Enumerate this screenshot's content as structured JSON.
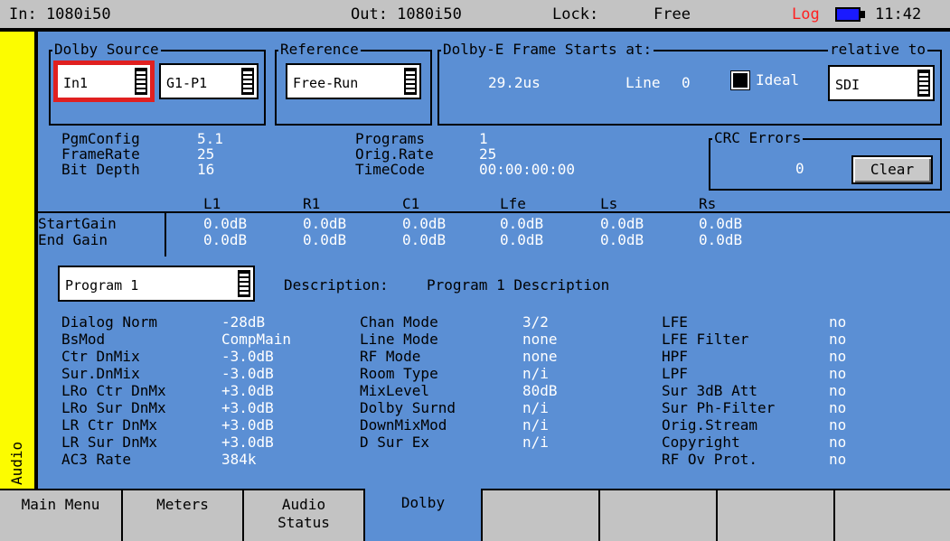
{
  "topbar": {
    "input": "In: 1080i50",
    "output": "Out: 1080i50",
    "lock_label": "Lock:",
    "lock_value": "Free",
    "log_label": "Log",
    "time": "11:42",
    "colors": {
      "log": "#ff2020",
      "battery": "#1a1aff"
    }
  },
  "side_label": "Audio",
  "dolby_source": {
    "label": "Dolby Source",
    "input_value": "In1",
    "program_value": "G1-P1"
  },
  "reference": {
    "label": "Reference",
    "value": "Free-Run"
  },
  "frame_start": {
    "label": "Dolby-E Frame Starts at:",
    "relative_label": "relative to",
    "time": "29.2us",
    "line_label": "Line",
    "line_value": "0",
    "ideal_label": "Ideal",
    "relative_value": "SDI"
  },
  "info_left": [
    {
      "label": "PgmConfig",
      "value": "5.1"
    },
    {
      "label": "FrameRate",
      "value": "25"
    },
    {
      "label": "Bit Depth",
      "value": "16"
    }
  ],
  "info_mid": [
    {
      "label": "Programs",
      "value": "1"
    },
    {
      "label": "Orig.Rate",
      "value": "25"
    },
    {
      "label": "TimeCode",
      "value": "00:00:00:00"
    }
  ],
  "crc": {
    "label": "CRC Errors",
    "value": "0",
    "clear_label": "Clear"
  },
  "gains": {
    "channels": [
      "L1",
      "R1",
      "C1",
      "Lfe",
      "Ls",
      "Rs"
    ],
    "start_label": "StartGain",
    "end_label": "End Gain",
    "start": [
      "0.0dB",
      "0.0dB",
      "0.0dB",
      "0.0dB",
      "0.0dB",
      "0.0dB"
    ],
    "end": [
      "0.0dB",
      "0.0dB",
      "0.0dB",
      "0.0dB",
      "0.0dB",
      "0.0dB"
    ]
  },
  "program": {
    "value": "Program 1",
    "description_label": "Description:",
    "description_value": "Program 1 Description"
  },
  "params_col1": [
    {
      "label": "Dialog Norm",
      "value": "-28dB"
    },
    {
      "label": "BsMod",
      "value": "CompMain"
    },
    {
      "label": "Ctr DnMix",
      "value": "-3.0dB"
    },
    {
      "label": "Sur.DnMix",
      "value": "-3.0dB"
    },
    {
      "label": "LRo Ctr DnMx",
      "value": "+3.0dB"
    },
    {
      "label": "LRo Sur DnMx",
      "value": "+3.0dB"
    },
    {
      "label": "LR Ctr DnMx",
      "value": "+3.0dB"
    },
    {
      "label": "LR Sur DnMx",
      "value": "+3.0dB"
    },
    {
      "label": "AC3 Rate",
      "value": "384k"
    }
  ],
  "params_col2": [
    {
      "label": "Chan Mode",
      "value": "3/2"
    },
    {
      "label": "Line Mode",
      "value": "none"
    },
    {
      "label": "RF Mode",
      "value": "none"
    },
    {
      "label": "Room Type",
      "value": "n/i"
    },
    {
      "label": "MixLevel",
      "value": "80dB"
    },
    {
      "label": "Dolby Surnd",
      "value": "n/i"
    },
    {
      "label": "DownMixMod",
      "value": "n/i"
    },
    {
      "label": "D Sur Ex",
      "value": "n/i"
    }
  ],
  "params_col3": [
    {
      "label": "LFE",
      "value": "no"
    },
    {
      "label": "LFE Filter",
      "value": "no"
    },
    {
      "label": "HPF",
      "value": "no"
    },
    {
      "label": "LPF",
      "value": "no"
    },
    {
      "label": "Sur 3dB Att",
      "value": "no"
    },
    {
      "label": "Sur Ph-Filter",
      "value": "no"
    },
    {
      "label": "Orig.Stream",
      "value": "no"
    },
    {
      "label": "Copyright",
      "value": "no"
    },
    {
      "label": "RF Ov Prot.",
      "value": "no"
    }
  ],
  "tabs": [
    {
      "label": "Main Menu",
      "active": false
    },
    {
      "label": "Meters",
      "active": false
    },
    {
      "label": "Audio\nStatus",
      "active": false
    },
    {
      "label": "Dolby",
      "active": true
    },
    {
      "label": "",
      "active": false
    },
    {
      "label": "",
      "active": false
    },
    {
      "label": "",
      "active": false
    },
    {
      "label": "",
      "active": false
    }
  ]
}
